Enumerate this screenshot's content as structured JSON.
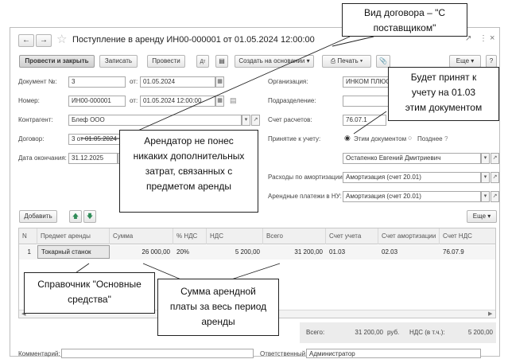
{
  "window": {
    "title": "Поступление в аренду ИН00-000001 от 01.05.2024 12:00:00"
  },
  "toolbar": {
    "post_close": "Провести и закрыть",
    "save": "Записать",
    "post": "Провести",
    "create_based": "Создать на основании",
    "print": "Печать",
    "more": "Еще"
  },
  "form": {
    "doc_no_label": "Документ №:",
    "doc_no_value": "3",
    "doc_from_label": "от:",
    "doc_date": "01.05.2024",
    "number_label": "Номер:",
    "number_value": "ИН00-000001",
    "number_from_label": "от:",
    "number_datetime": "01.05.2024 12:00:00",
    "counterparty_label": "Контрагент:",
    "counterparty_value": "Блеф ООО",
    "contract_label": "Договор:",
    "contract_value": "3 от 01.05.2024",
    "end_date_label": "Дата окончания:",
    "end_date_value": "31.12.2025",
    "org_label": "Организация:",
    "org_value": "ИНКОМ ПЛЮС",
    "division_label": "Подразделение:",
    "division_value": "",
    "settlement_label": "Счет расчетов:",
    "settlement_value": "76.07.1",
    "accept_label": "Принятие к учету:",
    "accept_opt1": "Этим документом",
    "accept_opt2": "Позднее",
    "responsible_value": "Остапенко Евгений Дмитриевич",
    "amort_exp_label": "Расходы по амортизации:",
    "amort_exp_value": "Амортизация (счет 20.01)",
    "rent_tax_label": "Арендные платежи в НУ:",
    "rent_tax_value": "Амортизация (счет 20.01)"
  },
  "table_toolbar": {
    "add": "Добавить",
    "more": "Еще"
  },
  "table": {
    "headers": [
      "N",
      "Предмет аренды",
      "Сумма",
      "% НДС",
      "НДС",
      "Всего",
      "Счет учета",
      "Счет амортизации",
      "Счет НДС"
    ],
    "rows": [
      [
        "1",
        "Токарный станок",
        "26 000,00",
        "20%",
        "5 200,00",
        "31 200,00",
        "01.03",
        "02.03",
        "76.07.9"
      ]
    ]
  },
  "totals": {
    "total_label": "Всего:",
    "total_value": "31 200,00",
    "currency": "руб.",
    "vat_label": "НДС (в т.ч.):",
    "vat_value": "5 200,00"
  },
  "footer": {
    "comment_label": "Комментарий:",
    "responsible_label": "Ответственный:",
    "responsible_value": "Администратор"
  },
  "callouts": {
    "contract_type": "Вид договора – \"С поставщиком\"",
    "accepted": "Будет принят к учету на 01.03 этим документом",
    "no_costs": "Арендатор не понес никаких дополнительных затрат, связанных с предметом аренды",
    "catalog": "Справочник \"Основные средства\"",
    "sum": "Сумма арендной платы за весь период аренды"
  }
}
